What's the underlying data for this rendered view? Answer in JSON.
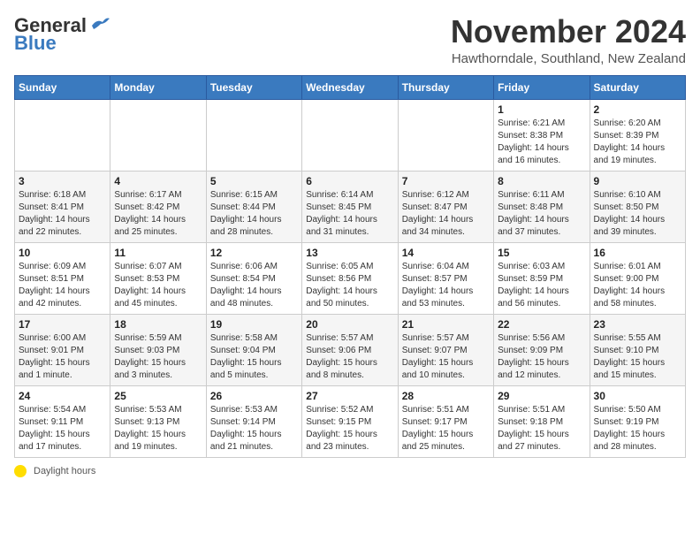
{
  "header": {
    "logo_line1": "General",
    "logo_line2": "Blue",
    "month_title": "November 2024",
    "location": "Hawthorndale, Southland, New Zealand"
  },
  "weekdays": [
    "Sunday",
    "Monday",
    "Tuesday",
    "Wednesday",
    "Thursday",
    "Friday",
    "Saturday"
  ],
  "weeks": [
    [
      {
        "day": "",
        "info": ""
      },
      {
        "day": "",
        "info": ""
      },
      {
        "day": "",
        "info": ""
      },
      {
        "day": "",
        "info": ""
      },
      {
        "day": "",
        "info": ""
      },
      {
        "day": "1",
        "info": "Sunrise: 6:21 AM\nSunset: 8:38 PM\nDaylight: 14 hours and 16 minutes."
      },
      {
        "day": "2",
        "info": "Sunrise: 6:20 AM\nSunset: 8:39 PM\nDaylight: 14 hours and 19 minutes."
      }
    ],
    [
      {
        "day": "3",
        "info": "Sunrise: 6:18 AM\nSunset: 8:41 PM\nDaylight: 14 hours and 22 minutes."
      },
      {
        "day": "4",
        "info": "Sunrise: 6:17 AM\nSunset: 8:42 PM\nDaylight: 14 hours and 25 minutes."
      },
      {
        "day": "5",
        "info": "Sunrise: 6:15 AM\nSunset: 8:44 PM\nDaylight: 14 hours and 28 minutes."
      },
      {
        "day": "6",
        "info": "Sunrise: 6:14 AM\nSunset: 8:45 PM\nDaylight: 14 hours and 31 minutes."
      },
      {
        "day": "7",
        "info": "Sunrise: 6:12 AM\nSunset: 8:47 PM\nDaylight: 14 hours and 34 minutes."
      },
      {
        "day": "8",
        "info": "Sunrise: 6:11 AM\nSunset: 8:48 PM\nDaylight: 14 hours and 37 minutes."
      },
      {
        "day": "9",
        "info": "Sunrise: 6:10 AM\nSunset: 8:50 PM\nDaylight: 14 hours and 39 minutes."
      }
    ],
    [
      {
        "day": "10",
        "info": "Sunrise: 6:09 AM\nSunset: 8:51 PM\nDaylight: 14 hours and 42 minutes."
      },
      {
        "day": "11",
        "info": "Sunrise: 6:07 AM\nSunset: 8:53 PM\nDaylight: 14 hours and 45 minutes."
      },
      {
        "day": "12",
        "info": "Sunrise: 6:06 AM\nSunset: 8:54 PM\nDaylight: 14 hours and 48 minutes."
      },
      {
        "day": "13",
        "info": "Sunrise: 6:05 AM\nSunset: 8:56 PM\nDaylight: 14 hours and 50 minutes."
      },
      {
        "day": "14",
        "info": "Sunrise: 6:04 AM\nSunset: 8:57 PM\nDaylight: 14 hours and 53 minutes."
      },
      {
        "day": "15",
        "info": "Sunrise: 6:03 AM\nSunset: 8:59 PM\nDaylight: 14 hours and 56 minutes."
      },
      {
        "day": "16",
        "info": "Sunrise: 6:01 AM\nSunset: 9:00 PM\nDaylight: 14 hours and 58 minutes."
      }
    ],
    [
      {
        "day": "17",
        "info": "Sunrise: 6:00 AM\nSunset: 9:01 PM\nDaylight: 15 hours and 1 minute."
      },
      {
        "day": "18",
        "info": "Sunrise: 5:59 AM\nSunset: 9:03 PM\nDaylight: 15 hours and 3 minutes."
      },
      {
        "day": "19",
        "info": "Sunrise: 5:58 AM\nSunset: 9:04 PM\nDaylight: 15 hours and 5 minutes."
      },
      {
        "day": "20",
        "info": "Sunrise: 5:57 AM\nSunset: 9:06 PM\nDaylight: 15 hours and 8 minutes."
      },
      {
        "day": "21",
        "info": "Sunrise: 5:57 AM\nSunset: 9:07 PM\nDaylight: 15 hours and 10 minutes."
      },
      {
        "day": "22",
        "info": "Sunrise: 5:56 AM\nSunset: 9:09 PM\nDaylight: 15 hours and 12 minutes."
      },
      {
        "day": "23",
        "info": "Sunrise: 5:55 AM\nSunset: 9:10 PM\nDaylight: 15 hours and 15 minutes."
      }
    ],
    [
      {
        "day": "24",
        "info": "Sunrise: 5:54 AM\nSunset: 9:11 PM\nDaylight: 15 hours and 17 minutes."
      },
      {
        "day": "25",
        "info": "Sunrise: 5:53 AM\nSunset: 9:13 PM\nDaylight: 15 hours and 19 minutes."
      },
      {
        "day": "26",
        "info": "Sunrise: 5:53 AM\nSunset: 9:14 PM\nDaylight: 15 hours and 21 minutes."
      },
      {
        "day": "27",
        "info": "Sunrise: 5:52 AM\nSunset: 9:15 PM\nDaylight: 15 hours and 23 minutes."
      },
      {
        "day": "28",
        "info": "Sunrise: 5:51 AM\nSunset: 9:17 PM\nDaylight: 15 hours and 25 minutes."
      },
      {
        "day": "29",
        "info": "Sunrise: 5:51 AM\nSunset: 9:18 PM\nDaylight: 15 hours and 27 minutes."
      },
      {
        "day": "30",
        "info": "Sunrise: 5:50 AM\nSunset: 9:19 PM\nDaylight: 15 hours and 28 minutes."
      }
    ]
  ],
  "legend": {
    "daylight_label": "Daylight hours"
  }
}
